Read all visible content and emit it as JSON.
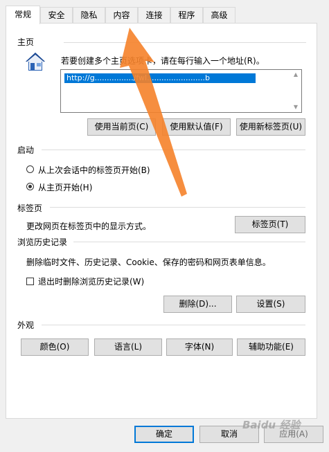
{
  "tabs": [
    "常规",
    "安全",
    "隐私",
    "内容",
    "连接",
    "程序",
    "高级"
  ],
  "home": {
    "group": "主页",
    "description": "若要创建多个主页选项卡，请在每行输入一个地址(R)。",
    "url": "http://g................/fwl........................b",
    "buttons": {
      "use_current": "使用当前页(C)",
      "use_default": "使用默认值(F)",
      "use_new_tab": "使用新标签页(U)"
    }
  },
  "startup": {
    "group": "启动",
    "option1": "从上次会话中的标签页开始(B)",
    "option2": "从主页开始(H)",
    "selected": 2
  },
  "tabs_section": {
    "group": "标签页",
    "description": "更改网页在标签页中的显示方式。",
    "button": "标签页(T)"
  },
  "history": {
    "group": "浏览历史记录",
    "description": "删除临时文件、历史记录、Cookie、保存的密码和网页表单信息。",
    "checkbox": "退出时删除浏览历史记录(W)",
    "delete_button": "删除(D)...",
    "settings_button": "设置(S)"
  },
  "appearance": {
    "group": "外观",
    "colors": "颜色(O)",
    "languages": "语言(L)",
    "fonts": "字体(N)",
    "accessibility": "辅助功能(E)"
  },
  "footer": {
    "ok": "确定",
    "cancel": "取消",
    "apply": "应用(A)"
  },
  "watermark": "Baidu 经验",
  "colors": {
    "accent": "#0078d7",
    "arrow": "#f5822a"
  }
}
